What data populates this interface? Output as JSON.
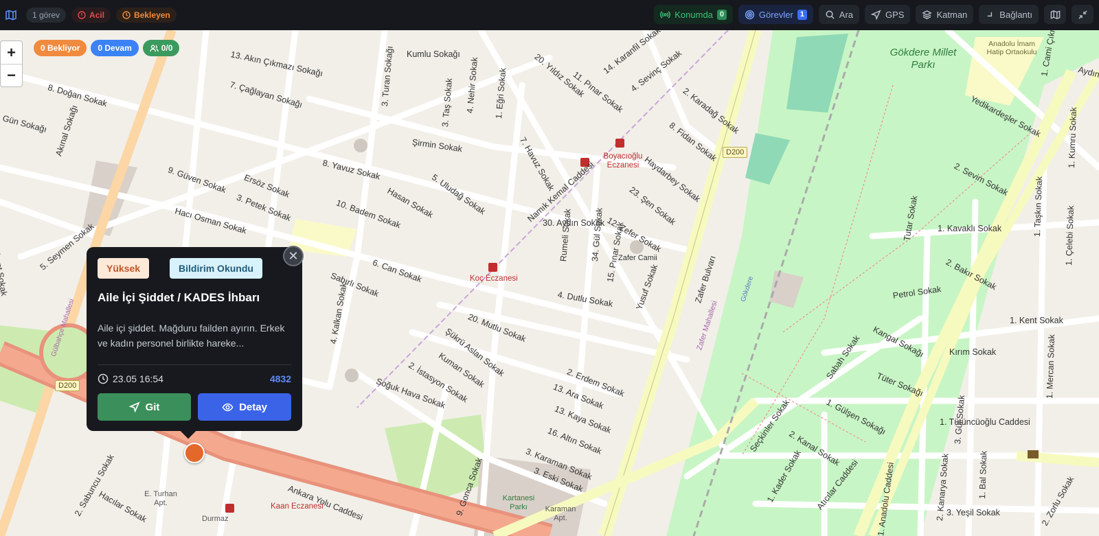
{
  "topbar": {
    "app_icon": "map-icon",
    "task_count": "1 görev",
    "urgent_label": "Acil",
    "pending_label": "Bekleyen",
    "buttons": {
      "location": {
        "label": "Konumda",
        "count": "0",
        "icon": "signal-icon"
      },
      "tasks": {
        "label": "Görevler",
        "count": "1",
        "icon": "target-icon"
      },
      "search": {
        "label": "Ara",
        "icon": "search-icon"
      },
      "gps": {
        "label": "GPS",
        "icon": "navigation-icon"
      },
      "layer": {
        "label": "Katman",
        "icon": "layers-icon"
      },
      "connection": {
        "label": "Bağlantı",
        "icon": "connection-icon"
      },
      "map_toggle": {
        "icon": "map-icon"
      },
      "minimize": {
        "icon": "minimize-icon"
      }
    },
    "colors": {
      "background": "#16181d",
      "urgent": "#e5484d",
      "pending": "#ef8a3a",
      "accent_green": "#3fc27a",
      "accent_blue": "#7da4ff"
    }
  },
  "map": {
    "zoom_in": "+",
    "zoom_out": "−",
    "stats": {
      "pending": "0 Bekliyor",
      "in_progress": "0 Devam",
      "units": "0/0"
    },
    "labels": {
      "streets": [
        "13. Akın Çıkmazı Sokağı",
        "Kumlu Sokağı",
        "8. Doğan Sokak",
        "7. Çağlayan Sokağı",
        "Gün Sokağı",
        "Akınal Sokağı",
        "9. Güven Sokak",
        "Ersöz Sokak",
        "3. Petek Sokak",
        "Hacı Osman Sokak",
        "5. Seymen Sokak",
        "Nalbant Sokak",
        "Şirmin Sokak",
        "8. Yavuz Sokak",
        "5. Uludağ Sokak",
        "Hasan Sokak",
        "10. Badem Sokak",
        "6. Can Sokak",
        "Sabırlı Sokak",
        "4. Kalkan Sokak",
        "Namık Kemal Caddesi",
        "30. Aydın Sokak",
        "12. Zefer Sokak",
        "Rumeli Sokak",
        "34. Gül Sokak",
        "15. Pınar Sokak",
        "4. Dutlu Sokak",
        "Yusuf Sokak",
        "20. Mutlu Sokak",
        "Şükrü Aslan Sokak",
        "Kuman Sokak",
        "2. İstasyon Sokak",
        "Soğuk Hava Sokak",
        "2. Erdem Sokak",
        "13. Ara Sokak",
        "13. Kaya Sokak",
        "16. Altın Sokak",
        "3. Karaman Sokak",
        "3. Eski Sokak",
        "9. Gonca Sokak",
        "Ankara Yolu Caddesi",
        "Hacılar Sokak",
        "2. Sabuncu Sokak",
        "Haydarbey Sokak",
        "23. Şen Sokak",
        "8. Fidan Sokak",
        "2. Karadağ Sokak",
        "4. Sevinç Sokak",
        "14. Karanfil Sokak",
        "11. Pınar Sokak",
        "20. Yıldız Sokak",
        "7. Havuz Sokak",
        "1. Eğri Sokak",
        "4. Nehir Sokak",
        "3. Taş Sokak",
        "3. Turan Sokağı",
        "Zafer Bulvarı",
        "Seçkinler Sokak",
        "Sabah Sokak",
        "Kangal Sokağı",
        "Tüter Sokağı",
        "1. Gülşen Sokağı",
        "2. Kanal Sokak",
        "1. Kader Sokak",
        "Atıcılar Caddesi",
        "1. Anadolu Caddesi",
        "2. Kanarya Sokak",
        "1. Bal Sokak",
        "2. Zorlu Sokak",
        "3. Yeşil Sokak",
        "1. Tütüncüoğlu Caddesi",
        "Kırım Sokak",
        "1. Kent Sokak",
        "Petrol Sokak",
        "2. Bakır Sokak",
        "1. Kavaklı Sokak",
        "Tutar Sokak",
        "2. Sevim Sokak",
        "Yedikardeşler Sokak",
        "1. Mercan Sokak",
        "3. Gül Sokak",
        "1. Taşkın Sokak",
        "1. Çelebi Sokak",
        "1. Kumru Sokak",
        "1. Cami Çıkmaz",
        "Aydıntepe Sokak"
      ],
      "places": [
        "Gökdere Millet Parkı",
        "Anadolu İmam Hatip Ortaokulu",
        "Boyacıoğlu Eczanesi",
        "Koç Eczanesi",
        "Zafer Camii",
        "Kartanesi Parkı",
        "Karaman Apt.",
        "E. Turhan Apt.",
        "Kaan Eczanesi",
        "Durmaz",
        "Zafer Mahallesi",
        "Gökdere",
        "Gülbahçe Mahallesi"
      ],
      "shields": [
        "D200",
        "D200"
      ]
    }
  },
  "popup": {
    "priority": "Yüksek",
    "status": "Bildirim Okundu",
    "title": "Aile İçi Şiddet / KADES İhbarı",
    "description": "Aile içi şiddet. Mağduru failden ayırın. Erkek ve kadın personel birlikte hareke...",
    "time": "23.05 16:54",
    "id": "4832",
    "go_label": "Git",
    "detail_label": "Detay",
    "close_icon": "close-icon",
    "colors": {
      "priority_bg": "#fde9d8",
      "priority_text": "#c0562a",
      "status_bg": "#d8f2fb",
      "status_text": "#1f5c7a",
      "go": "#3b8f5a",
      "detail": "#3a63e8",
      "id_color": "#5b8ef7"
    }
  },
  "marker": {
    "color": "#e4682a"
  }
}
